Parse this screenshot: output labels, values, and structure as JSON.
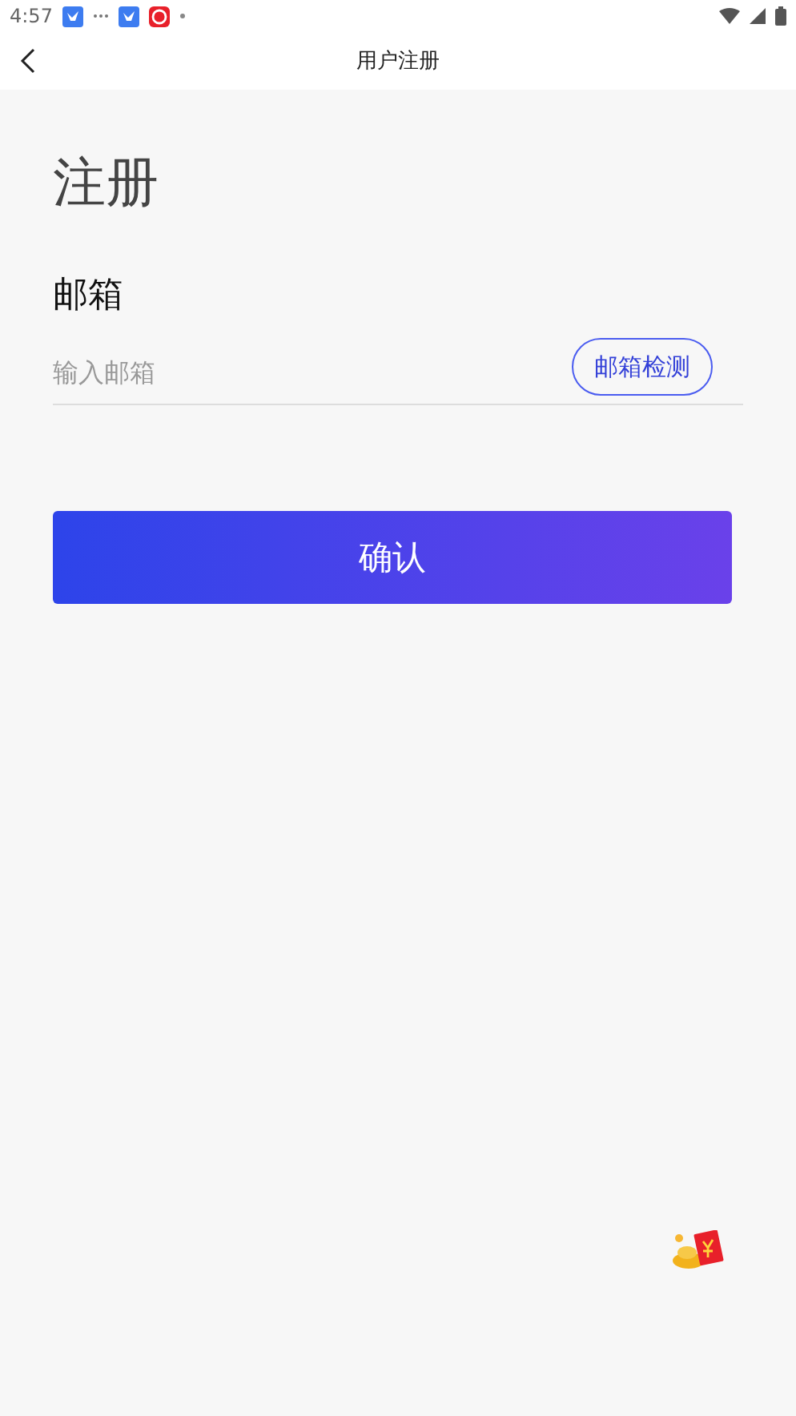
{
  "status_bar": {
    "time": "4:57"
  },
  "header": {
    "title": "用户注册"
  },
  "heading": "注册",
  "email": {
    "label": "邮箱",
    "placeholder": "输入邮箱",
    "check_button": "邮箱检测"
  },
  "confirm_button": "确认"
}
